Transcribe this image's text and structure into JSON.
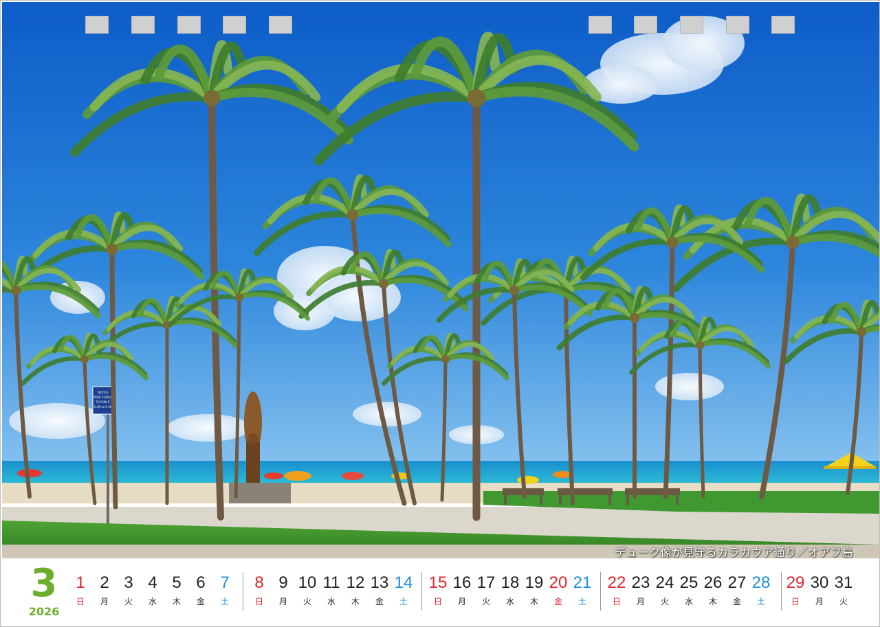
{
  "caption": "デューク像が見守るカラカウア通り／オアフ島",
  "month": "3",
  "year": "2026",
  "days": [
    {
      "n": "1",
      "w": "日",
      "t": "sun"
    },
    {
      "n": "2",
      "w": "月",
      "t": "wk"
    },
    {
      "n": "3",
      "w": "火",
      "t": "wk"
    },
    {
      "n": "4",
      "w": "水",
      "t": "wk"
    },
    {
      "n": "5",
      "w": "木",
      "t": "wk"
    },
    {
      "n": "6",
      "w": "金",
      "t": "wk"
    },
    {
      "n": "7",
      "w": "土",
      "t": "sat"
    },
    {
      "n": "8",
      "w": "日",
      "t": "sun"
    },
    {
      "n": "9",
      "w": "月",
      "t": "wk"
    },
    {
      "n": "10",
      "w": "火",
      "t": "wk"
    },
    {
      "n": "11",
      "w": "水",
      "t": "wk"
    },
    {
      "n": "12",
      "w": "木",
      "t": "wk"
    },
    {
      "n": "13",
      "w": "金",
      "t": "wk"
    },
    {
      "n": "14",
      "w": "土",
      "t": "sat"
    },
    {
      "n": "15",
      "w": "日",
      "t": "sun"
    },
    {
      "n": "16",
      "w": "月",
      "t": "wk"
    },
    {
      "n": "17",
      "w": "火",
      "t": "wk"
    },
    {
      "n": "18",
      "w": "水",
      "t": "wk"
    },
    {
      "n": "19",
      "w": "木",
      "t": "wk"
    },
    {
      "n": "20",
      "w": "金",
      "t": "hol"
    },
    {
      "n": "21",
      "w": "土",
      "t": "sat"
    },
    {
      "n": "22",
      "w": "日",
      "t": "sun"
    },
    {
      "n": "23",
      "w": "月",
      "t": "wk"
    },
    {
      "n": "24",
      "w": "火",
      "t": "wk"
    },
    {
      "n": "25",
      "w": "水",
      "t": "wk"
    },
    {
      "n": "26",
      "w": "木",
      "t": "wk"
    },
    {
      "n": "27",
      "w": "金",
      "t": "wk"
    },
    {
      "n": "28",
      "w": "土",
      "t": "sat"
    },
    {
      "n": "29",
      "w": "日",
      "t": "sun"
    },
    {
      "n": "30",
      "w": "月",
      "t": "wk"
    },
    {
      "n": "31",
      "w": "火",
      "t": "wk"
    }
  ],
  "colors": {
    "month_green": "#6cae2c",
    "sunday_red": "#e0262d",
    "saturday_blue": "#1f8fd6",
    "sky": "#1e6fd0",
    "ocean": "#1aa3c9",
    "grass": "#3a8a2a"
  },
  "photo": {
    "sign_text_1": "NOTICE",
    "sign_text_2": "PARK CLOSED",
    "sign_text_3": "TO PUBLIC",
    "sign_text_4": "2 AM to 5 AM"
  }
}
